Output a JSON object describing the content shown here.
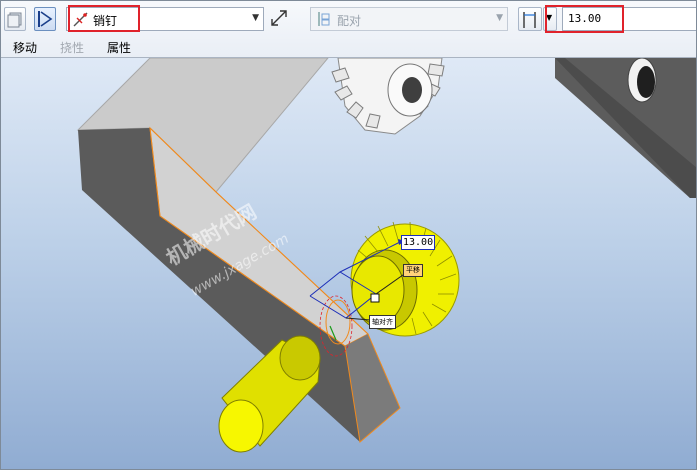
{
  "toolbar": {
    "constraint_type": "销钉",
    "constraint_mode": "配对",
    "offset_value": "13.00"
  },
  "tabs": [
    {
      "label": "移动",
      "enabled": true
    },
    {
      "label": "挠性",
      "enabled": false
    },
    {
      "label": "属性",
      "enabled": true
    }
  ],
  "viewport": {
    "dimension_label": "13.00",
    "tag_pin": "平移",
    "tag_rotate": "轴对齐",
    "watermark_cn": "机械时代网",
    "watermark_url": "www.jxage.com"
  },
  "colors": {
    "highlight": "#e0222b",
    "part_gray_top": "#c9c9c9",
    "part_gray_side": "#5a5a5a",
    "gear_yellow": "#f0f000",
    "edge_orange": "#f08a1e",
    "dim_blue": "#1d2fb8"
  },
  "icons": {
    "placement_icon": "placement-icon",
    "pin_icon": "pin-icon",
    "flip_icon": "flip-icon",
    "mate_icon": "mate-icon",
    "offset_icon": "offset-icon"
  }
}
